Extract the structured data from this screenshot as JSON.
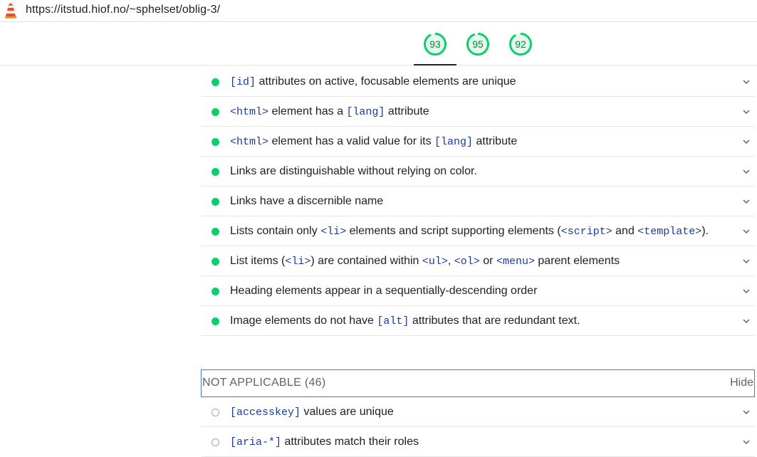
{
  "address_bar": {
    "url": "https://itstud.hiof.no/~sphelset/oblig-3/",
    "logo_icon": "lighthouse-icon"
  },
  "scores": [
    {
      "value": "93",
      "color": "#0cce6b"
    },
    {
      "value": "95",
      "color": "#0cce6b"
    },
    {
      "value": "92",
      "color": "#0cce6b"
    }
  ],
  "passed_audits": [
    {
      "parts": [
        {
          "code": "[id]"
        },
        {
          "text": " attributes on active, focusable elements are unique"
        }
      ]
    },
    {
      "parts": [
        {
          "code": "<html>"
        },
        {
          "text": " element has a "
        },
        {
          "code": "[lang]"
        },
        {
          "text": " attribute"
        }
      ]
    },
    {
      "parts": [
        {
          "code": "<html>"
        },
        {
          "text": " element has a valid value for its "
        },
        {
          "code": "[lang]"
        },
        {
          "text": " attribute"
        }
      ]
    },
    {
      "parts": [
        {
          "text": "Links are distinguishable without relying on color."
        }
      ]
    },
    {
      "parts": [
        {
          "text": "Links have a discernible name"
        }
      ]
    },
    {
      "parts": [
        {
          "text": "Lists contain only "
        },
        {
          "code": "<li>"
        },
        {
          "text": " elements and script supporting elements ("
        },
        {
          "code": "<script>"
        },
        {
          "text": " and "
        },
        {
          "code": "<template>"
        },
        {
          "text": ")."
        }
      ]
    },
    {
      "parts": [
        {
          "text": "List items ("
        },
        {
          "code": "<li>"
        },
        {
          "text": ") are contained within "
        },
        {
          "code": "<ul>"
        },
        {
          "text": ", "
        },
        {
          "code": "<ol>"
        },
        {
          "text": " or "
        },
        {
          "code": "<menu>"
        },
        {
          "text": " parent elements"
        }
      ]
    },
    {
      "parts": [
        {
          "text": "Heading elements appear in a sequentially-descending order"
        }
      ]
    },
    {
      "parts": [
        {
          "text": "Image elements do not have "
        },
        {
          "code": "[alt]"
        },
        {
          "text": " attributes that are redundant text."
        }
      ]
    }
  ],
  "not_applicable": {
    "label": "NOT APPLICABLE",
    "count": "(46)",
    "hide_label": "Hide",
    "audits": [
      {
        "parts": [
          {
            "code": "[accesskey]"
          },
          {
            "text": " values are unique"
          }
        ]
      },
      {
        "parts": [
          {
            "code": "[aria-*]"
          },
          {
            "text": " attributes match their roles"
          }
        ]
      }
    ]
  },
  "colors": {
    "pass": "#0cce6b",
    "pass_text": "#008a3a",
    "code": "#1a3b9e",
    "focus_border": "#3d7bd9"
  }
}
